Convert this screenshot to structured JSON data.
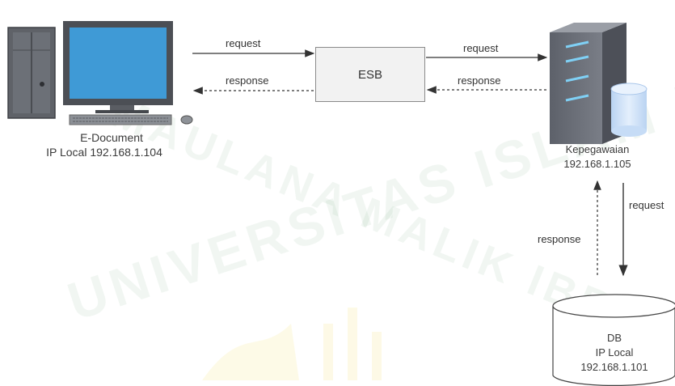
{
  "watermark": {
    "line1": "UNIVERSITAS ISLAM NEGERI",
    "line2": "MAULANA MALIK IBRAHIM"
  },
  "nodes": {
    "edocument": {
      "name": "E-Document",
      "ip": "IP Local 192.168.1.104"
    },
    "esb": {
      "name": "ESB"
    },
    "kepegawaian": {
      "name": "Kepegawaian",
      "ip": "192.168.1.105"
    },
    "db": {
      "name": "DB",
      "ip_label": "IP Local",
      "ip": "192.168.1.101"
    }
  },
  "edges": {
    "edoc_to_esb": "request",
    "esb_to_edoc": "response",
    "esb_to_kep": "request",
    "kep_to_esb": "response",
    "kep_to_db": "request",
    "db_to_kep": "response"
  },
  "colors": {
    "monitor_screen": "#3f9ad6",
    "server_body": "#6b6f78",
    "server_lights": "#7fd0f5",
    "db_cylinder": "#cfe2f8",
    "esb_fill": "#f2f2f2",
    "arrow": "#333333"
  }
}
